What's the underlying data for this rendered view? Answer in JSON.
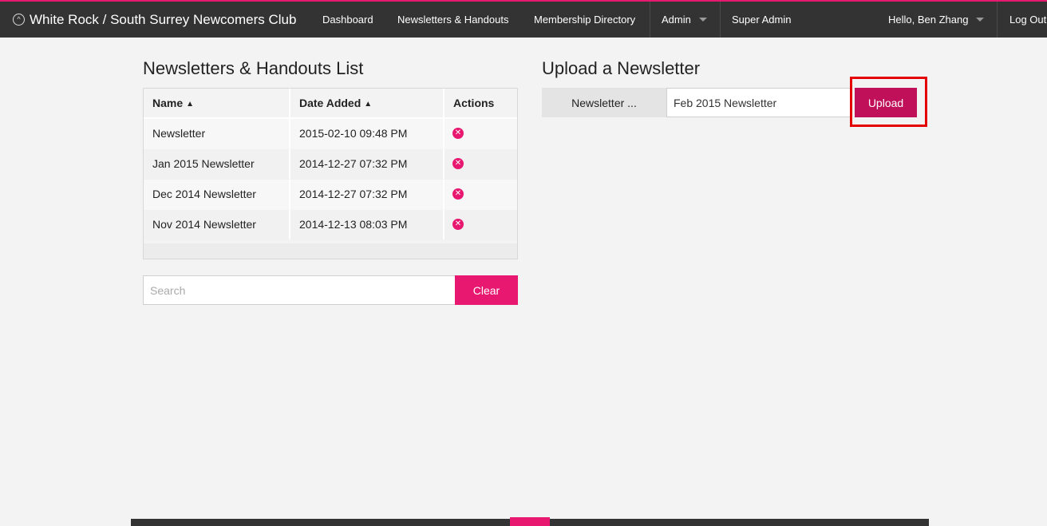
{
  "header": {
    "brand_icon": "chevron-up-circle-icon",
    "brand": "White Rock / South Surrey Newcomers Club",
    "nav": {
      "dashboard": "Dashboard",
      "newsletters": "Newsletters & Handouts",
      "directory": "Membership Directory",
      "admin": "Admin",
      "super_admin": "Super Admin",
      "user": "Hello, Ben Zhang",
      "logout": "Log Out"
    },
    "accent_color": "#e8176f",
    "bar_color": "#333333"
  },
  "list": {
    "title": "Newsletters & Handouts List",
    "columns": {
      "name": "Name",
      "date": "Date Added",
      "actions": "Actions"
    },
    "sort_icon": "sort-icon",
    "rows": [
      {
        "name": "Newsletter",
        "date": "2015-02-10 09:48 PM",
        "action_icon": "delete-icon"
      },
      {
        "name": "Jan 2015 Newsletter",
        "date": "2014-12-27 07:32 PM",
        "action_icon": "delete-icon"
      },
      {
        "name": "Dec 2014 Newsletter",
        "date": "2014-12-27 07:32 PM",
        "action_icon": "delete-icon"
      },
      {
        "name": "Nov 2014 Newsletter",
        "date": "2014-12-13 08:03 PM",
        "action_icon": "delete-icon"
      }
    ],
    "search_placeholder": "Search",
    "clear_label": "Clear"
  },
  "upload": {
    "title": "Upload a Newsletter",
    "file_label": "Newsletter ...",
    "name_value": "Feb 2015 Newsletter",
    "upload_label": "Upload",
    "highlight_color": "#e40000"
  }
}
